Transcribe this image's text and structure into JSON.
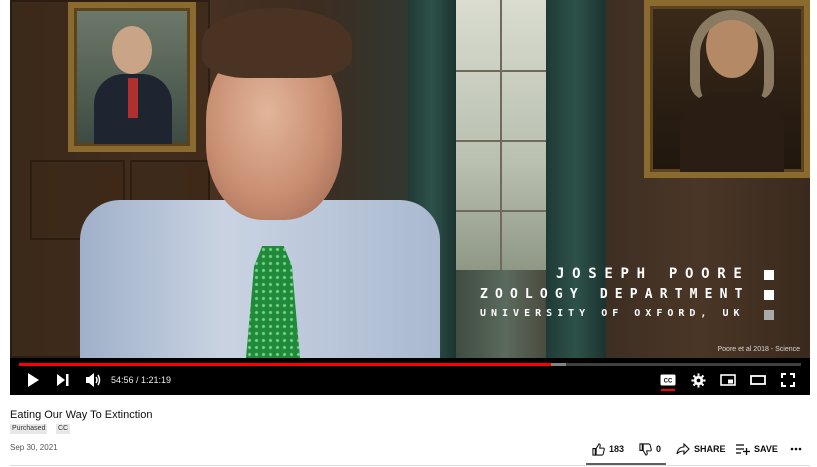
{
  "video": {
    "overlay_name": "JOSEPH POORE",
    "overlay_department": "ZOOLOGY DEPARTMENT",
    "overlay_university": "UNIVERSITY OF OXFORD, UK",
    "credit": "Poore et al 2018 - Science"
  },
  "player": {
    "time_display": "54:56 / 1:21:19",
    "played_fraction": 0.68,
    "loaded_fraction": 0.7,
    "accent_color": "#ff0000",
    "icons": [
      "play-icon",
      "next-icon",
      "volume-icon",
      "cc-icon",
      "settings-icon",
      "miniplayer-icon",
      "theater-icon",
      "fullscreen-icon"
    ]
  },
  "meta": {
    "title": "Eating Our Way To Extinction",
    "badges": [
      "Purchased",
      "CC"
    ],
    "date": "Sep 30, 2021"
  },
  "actions": {
    "like_count": "183",
    "dislike_count": "0",
    "share_label": "SHARE",
    "save_label": "SAVE"
  }
}
